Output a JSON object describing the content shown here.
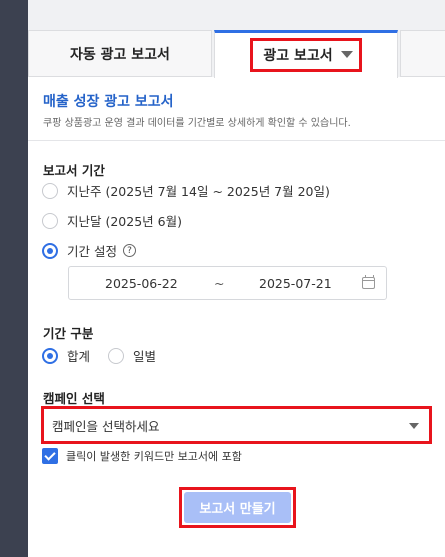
{
  "tabs": [
    {
      "label": "자동 광고 보고서"
    },
    {
      "label": "광고 보고서"
    },
    {
      "label": ""
    }
  ],
  "header": {
    "title": "매출 성장 광고 보고서",
    "description": "쿠팡 상품광고 운영 결과 데이터를 기간별로 상세하게 확인할 수 있습니다."
  },
  "period": {
    "label": "보고서 기간",
    "options": [
      {
        "label": "지난주 (2025년 7월 14일 ~ 2025년 7월 20일)"
      },
      {
        "label": "지난달 (2025년 6월)"
      },
      {
        "label": "기간 설정"
      }
    ],
    "start_date": "2025-06-22",
    "separator": "~",
    "end_date": "2025-07-21",
    "help": "?"
  },
  "breakdown": {
    "label": "기간 구분",
    "options": [
      {
        "label": "합계"
      },
      {
        "label": "일별"
      }
    ]
  },
  "campaign": {
    "label": "캠페인 선택",
    "placeholder": "캠페인을 선택하세요",
    "checkbox_label": "클릭이 발생한 키워드만 보고서에 포함"
  },
  "create_button": "보고서 만들기",
  "colors": {
    "accent": "#2f6fe4",
    "highlight": "#e8141c",
    "button": "#a9bff7"
  }
}
